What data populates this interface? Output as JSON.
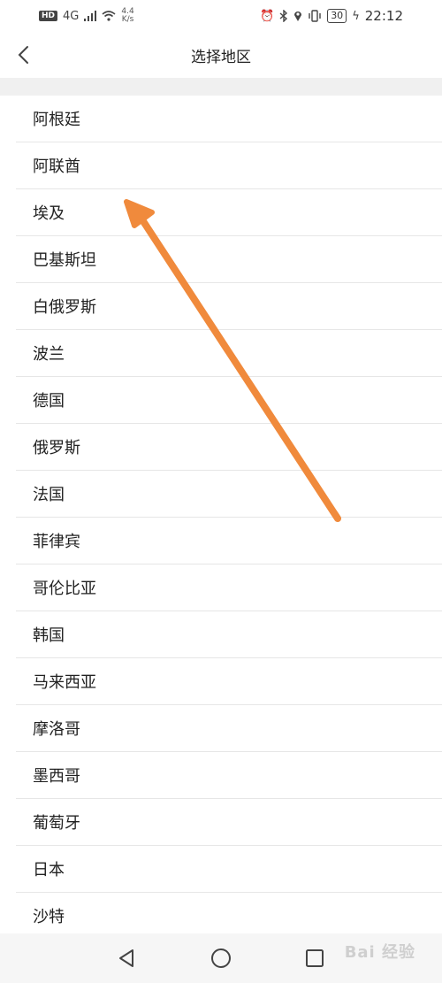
{
  "status_bar": {
    "hd": "HD",
    "signal": "4G",
    "speed_value": "4.4",
    "speed_unit": "K/s",
    "battery": "30",
    "time": "22:12"
  },
  "header": {
    "title": "选择地区"
  },
  "regions": [
    "阿根廷",
    "阿联酋",
    "埃及",
    "巴基斯坦",
    "白俄罗斯",
    "波兰",
    "德国",
    "俄罗斯",
    "法国",
    "菲律宾",
    "哥伦比亚",
    "韩国",
    "马来西亚",
    "摩洛哥",
    "墨西哥",
    "葡萄牙",
    "日本",
    "沙特"
  ],
  "watermark": "Bai 经验",
  "colors": {
    "arrow": "#f08a3c",
    "divider": "#e6e6e6",
    "band": "#f0f0f0"
  }
}
